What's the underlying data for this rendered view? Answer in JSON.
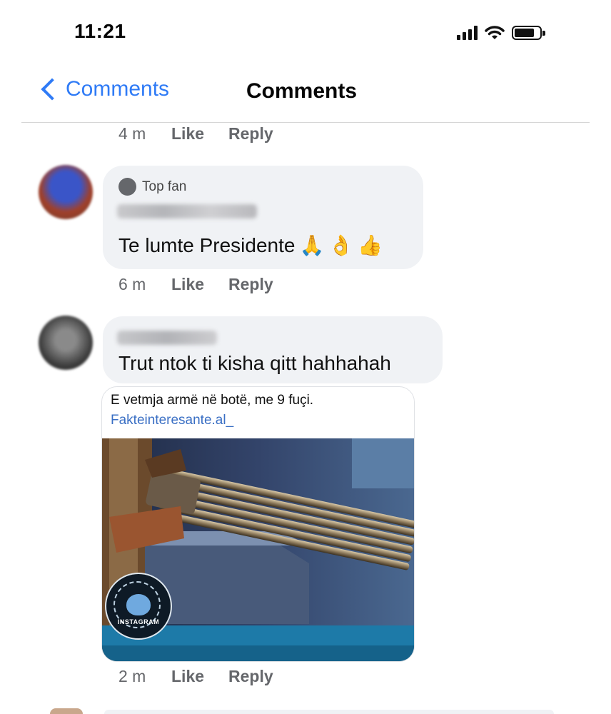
{
  "status_bar": {
    "time": "11:21"
  },
  "nav": {
    "back_label": "Comments",
    "title": "Comments"
  },
  "comments": [
    {
      "time_ago": "4 m",
      "like": "Like",
      "reply": "Reply"
    },
    {
      "badge": "Top fan",
      "text": "Te lumte Presidente",
      "emojis": [
        "🙏",
        "👌",
        "👍"
      ],
      "time_ago": "6 m",
      "like": "Like",
      "reply": "Reply"
    },
    {
      "text": "Trut ntok ti kisha qitt hahhahah",
      "shared_post": {
        "caption": "E vetmja armë në botë, me 9 fuçi.",
        "link": "Fakteinteresante.al_",
        "watermark": "INSTAGRAM"
      },
      "time_ago": "2 m",
      "like": "Like",
      "reply": "Reply"
    }
  ],
  "icons": {
    "signal": "cellular-signal-icon",
    "wifi": "wifi-icon",
    "battery": "battery-icon",
    "back": "chevron-left-icon"
  },
  "colors": {
    "accent": "#2f7bf6",
    "bubble": "#f0f2f5",
    "meta_text": "#65676b"
  }
}
